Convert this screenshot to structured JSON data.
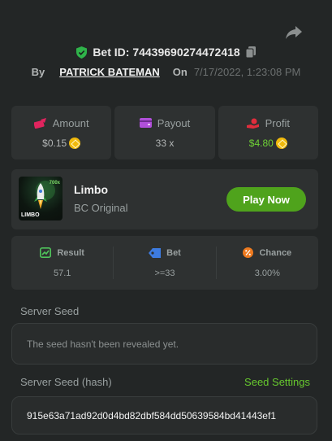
{
  "header": {
    "bet_id": "Bet ID: 7443969027447241​8",
    "by_label": "By",
    "username": "PATRICK BATEMAN",
    "on_label": "On",
    "date": "7/17/2022, 1:23:08 PM",
    "icons": {
      "share": "share-icon",
      "shield": "shield-check-icon",
      "copy": "copy-icon"
    }
  },
  "stats": [
    {
      "label": "Amount",
      "value": "$0.15",
      "icon": "money-wing-icon"
    },
    {
      "label": "Payout",
      "value": "33 x",
      "icon": "wallet-icon"
    },
    {
      "label": "Profit",
      "value": "$4.80",
      "icon": "hand-coin-icon"
    }
  ],
  "game": {
    "name": "Limbo",
    "provider": "BC Original",
    "thumb_label": "LIMBO",
    "thumb_multiplier": "700x",
    "play_button": "Play Now"
  },
  "results": [
    {
      "label": "Result",
      "value": "57.1",
      "icon": "chart-icon"
    },
    {
      "label": "Bet",
      "value": ">=33",
      "icon": "tag-icon"
    },
    {
      "label": "Chance",
      "value": "3.00%",
      "icon": "percent-icon"
    }
  ],
  "server_seed": {
    "label": "Server Seed",
    "value": "The seed hasn't been revealed yet."
  },
  "server_seed_hash": {
    "label": "Server Seed (hash)",
    "settings_link": "Seed Settings",
    "value": "915e63a71ad92d0d4bd82dbf584dd50639584bd41443ef1"
  },
  "colors": {
    "background": "#232626",
    "card": "#2e3131",
    "accent_green": "#4fa31c",
    "link_green": "#67c92e",
    "profit_green": "#6fd136",
    "coin": "#f0b90b"
  }
}
